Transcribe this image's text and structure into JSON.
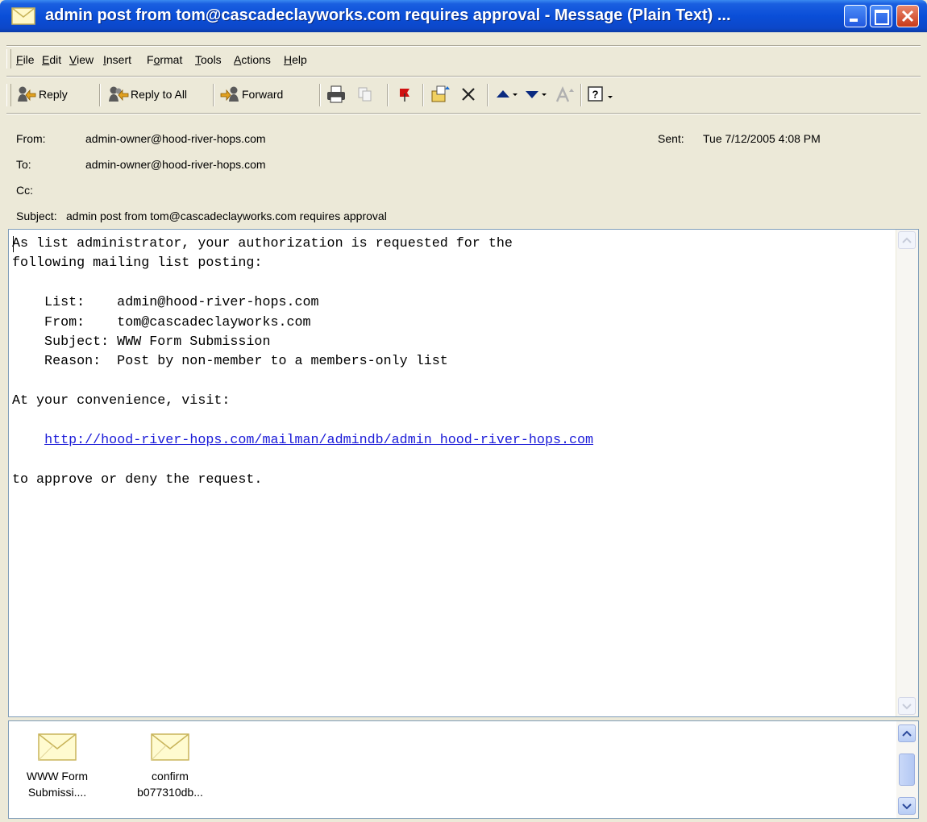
{
  "window": {
    "title": "admin post from tom@cascadeclayworks.com requires approval - Message (Plain Text) ..."
  },
  "menu": {
    "items": [
      "File",
      "Edit",
      "View",
      "Insert",
      "Format",
      "Tools",
      "Actions",
      "Help"
    ]
  },
  "toolbar": {
    "reply_label": "Reply",
    "reply_all_label": "Reply to All",
    "forward_label": "Forward"
  },
  "header": {
    "from_label": "From:",
    "from_value": "admin-owner@hood-river-hops.com",
    "sent_label": "Sent:",
    "sent_value": "Tue 7/12/2005 4:08 PM",
    "to_label": "To:",
    "to_value": "admin-owner@hood-river-hops.com",
    "cc_label": "Cc:",
    "cc_value": "",
    "subject_label": "Subject:",
    "subject_value": "admin post from tom@cascadeclayworks.com requires approval"
  },
  "body": {
    "line1": "As list administrator, your authorization is requested for the",
    "line2": "following mailing list posting:",
    "list_line": "    List:    admin@hood-river-hops.com",
    "from_line": "    From:    tom@cascadeclayworks.com",
    "subject_line": "    Subject: WWW Form Submission",
    "reason_line": "    Reason:  Post by non-member to a members-only list",
    "visit_line": "At your convenience, visit:",
    "link_indent": "    ",
    "link": "http://hood-river-hops.com/mailman/admindb/admin_hood-river-hops.com",
    "closing_line": "to approve or deny the request."
  },
  "attachments": [
    {
      "line1": "WWW Form",
      "line2": "Submissi...."
    },
    {
      "line1": "confirm",
      "line2": "b077310db..."
    }
  ],
  "colors": {
    "titlebar": "#0a4ed8",
    "chrome": "#ece9d8",
    "link": "#1a1ad8"
  }
}
